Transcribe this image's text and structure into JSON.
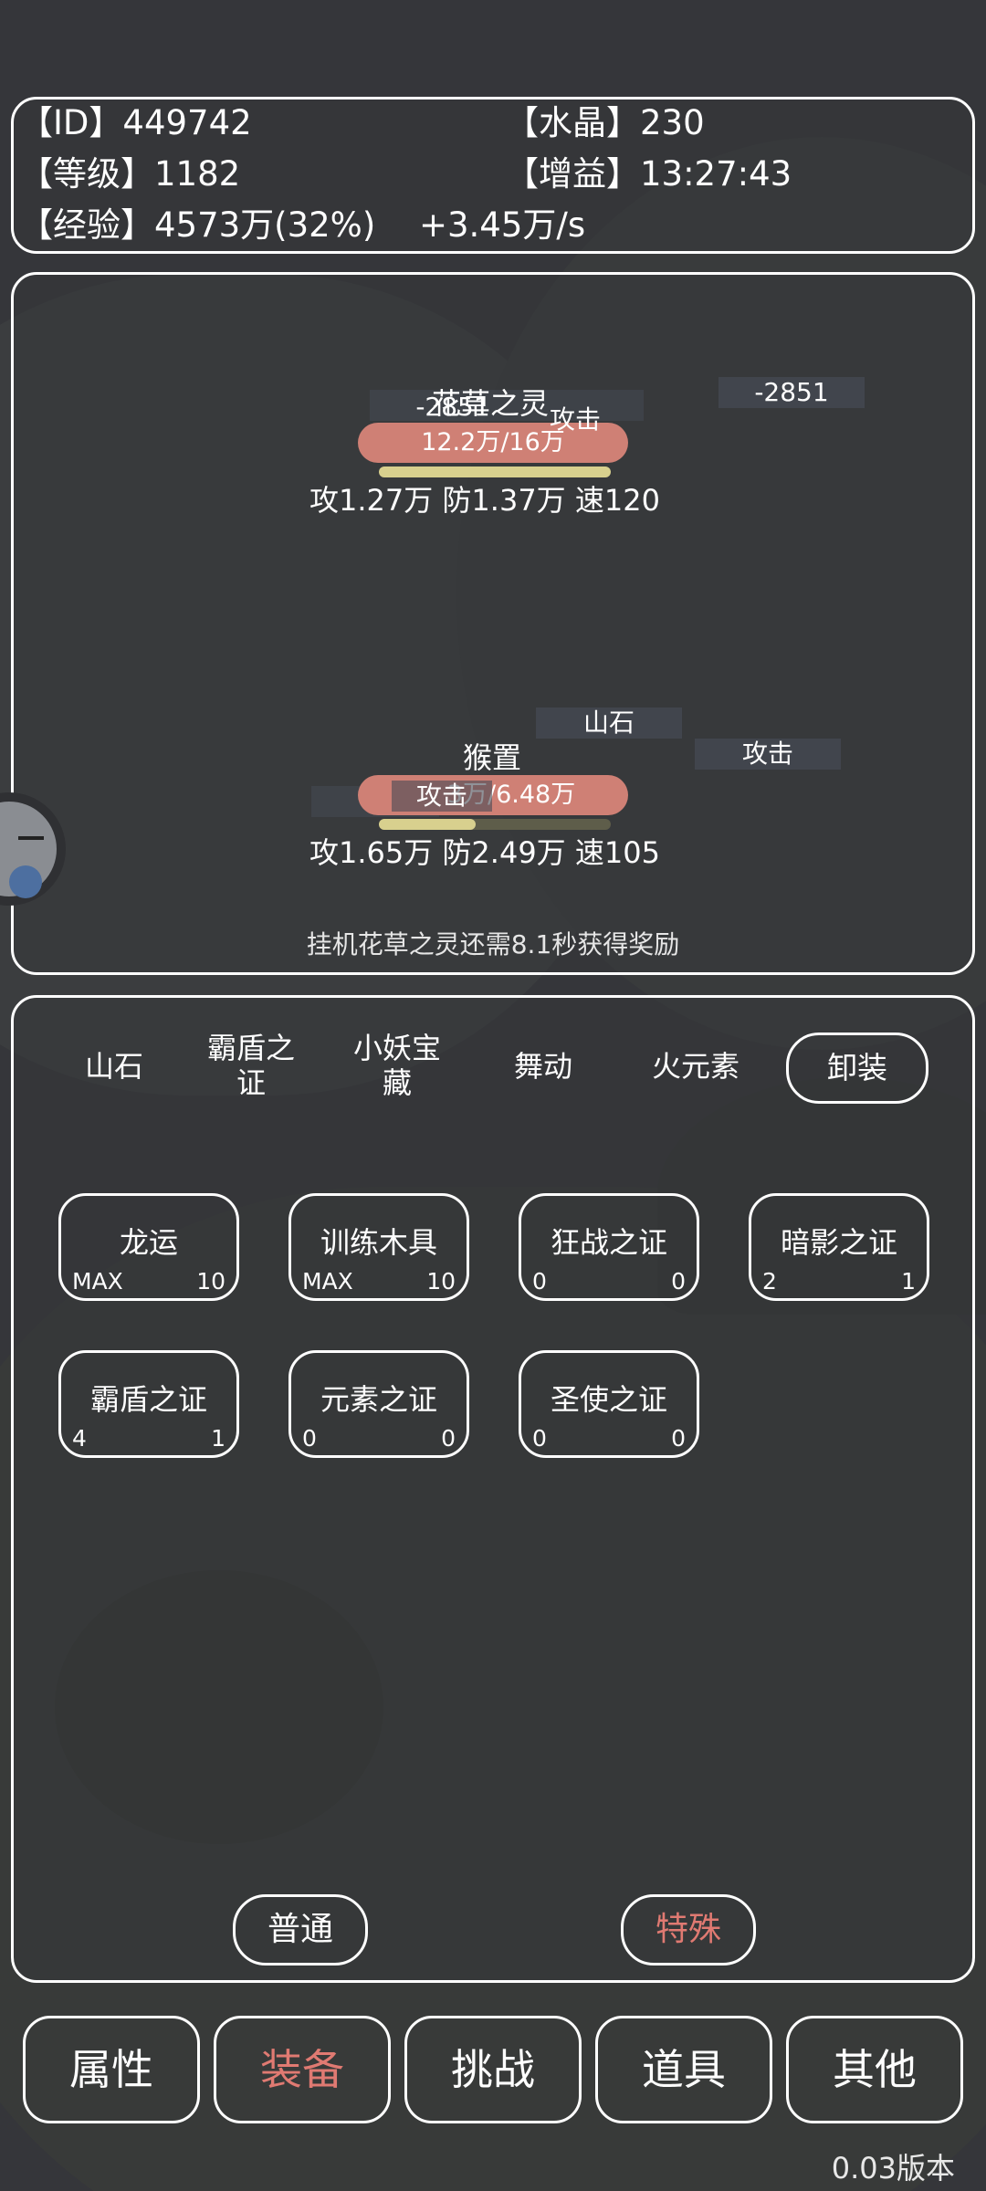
{
  "info": {
    "id_label": "【ID】449742",
    "crystal_label": "【水晶】230",
    "level_label": "【等级】1182",
    "buff_label": "【增益】13:27:43",
    "exp_label": "【经验】4573万(32%)",
    "exp_rate": "+3.45万/s"
  },
  "battle": {
    "enemy": {
      "name": "花草之灵",
      "dmg_left": "-2851",
      "dmg_right": "-2851",
      "action": "攻击",
      "hp": "12.2万/16万",
      "stats": "攻1.27万  防1.37万  速120"
    },
    "player": {
      "name": "猴置",
      "skill_label": "山石",
      "action_right": "攻击",
      "action_bar": "攻击",
      "dmg": "-0",
      "hp": "3万/6.48万",
      "stats": "攻1.65万  防2.49万  速105"
    },
    "hint": "挂机花草之灵还需8.1秒获得奖励"
  },
  "equip": {
    "categories": [
      "山石",
      "霸盾之\n证",
      "小妖宝\n藏",
      "舞动",
      "火元素"
    ],
    "unequip_label": "卸装",
    "slots": [
      {
        "name": "龙运",
        "left": "MAX",
        "right": "10"
      },
      {
        "name": "训练木具",
        "left": "MAX",
        "right": "10"
      },
      {
        "name": "狂战之证",
        "left": "0",
        "right": "0"
      },
      {
        "name": "暗影之证",
        "left": "2",
        "right": "1"
      },
      {
        "name": "霸盾之证",
        "left": "4",
        "right": "1"
      },
      {
        "name": "元素之证",
        "left": "0",
        "right": "0"
      },
      {
        "name": "圣使之证",
        "left": "0",
        "right": "0"
      }
    ],
    "mode_normal": "普通",
    "mode_special": "特殊"
  },
  "nav": [
    "属性",
    "装备",
    "挑战",
    "道具",
    "其他"
  ],
  "version": "0.03版本",
  "colors": {
    "accent": "#e07a72",
    "hp_bar": "#cf8075",
    "exp_bar": "#d8d08e"
  }
}
